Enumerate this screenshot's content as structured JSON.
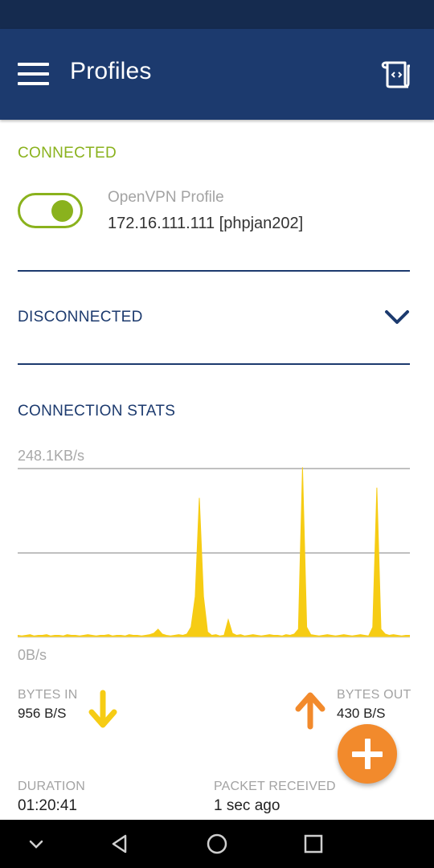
{
  "app_bar": {
    "title": "Profiles",
    "menu_icon": "hamburger-menu-icon",
    "import_icon": "import-profile-icon",
    "background": "#1c3a6e"
  },
  "connected_section": {
    "label": "CONNECTED",
    "color": "#8ab21d",
    "profile": {
      "name": "OpenVPN Profile",
      "host": "172.16.111.111 [phpjan202]",
      "toggle_on": true
    }
  },
  "disconnected_section": {
    "label": "DISCONNECTED",
    "expand_icon": "chevron-down-icon"
  },
  "connection_stats": {
    "label": "CONNECTION STATS",
    "max_rate": "248.1KB/s",
    "min_rate": "0B/s",
    "bytes_in": {
      "label": "BYTES IN",
      "value": "956 B/S",
      "icon": "arrow-down-icon",
      "color": "#f6cc14"
    },
    "bytes_out": {
      "label": "BYTES OUT",
      "value": "430 B/S",
      "icon": "arrow-up-icon",
      "color": "#f28a2c"
    },
    "duration": {
      "label": "DURATION",
      "value": "01:20:41"
    },
    "packet_received": {
      "label": "PACKET RECEIVED",
      "value": "1 sec ago"
    }
  },
  "fab": {
    "icon": "plus-icon",
    "color": "#f28a2c"
  },
  "chart_data": {
    "type": "area",
    "ylim": [
      0,
      248.1
    ],
    "ylabel_unit": "KB/s",
    "grid": true,
    "color": "#f6cc14",
    "values": [
      3,
      2,
      3,
      4,
      2,
      3,
      3,
      4,
      2,
      3,
      3,
      2,
      4,
      3,
      3,
      2,
      3,
      4,
      3,
      2,
      3,
      3,
      4,
      2,
      3,
      3,
      2,
      4,
      3,
      3,
      2,
      3,
      4,
      6,
      12,
      5,
      3,
      2,
      3,
      4,
      3,
      5,
      15,
      60,
      205,
      60,
      8,
      3,
      4,
      2,
      3,
      26,
      6,
      3,
      4,
      2,
      3,
      4,
      3,
      2,
      3,
      4,
      3,
      3,
      2,
      4,
      3,
      5,
      12,
      250,
      15,
      4,
      3,
      2,
      3,
      4,
      3,
      2,
      3,
      4,
      3,
      2,
      3,
      4,
      3,
      2,
      15,
      220,
      12,
      5,
      3,
      4,
      3,
      2,
      3,
      3
    ]
  },
  "nav_bar": {
    "items": [
      "collapse-down-icon",
      "back-icon",
      "home-icon",
      "recents-icon"
    ]
  }
}
